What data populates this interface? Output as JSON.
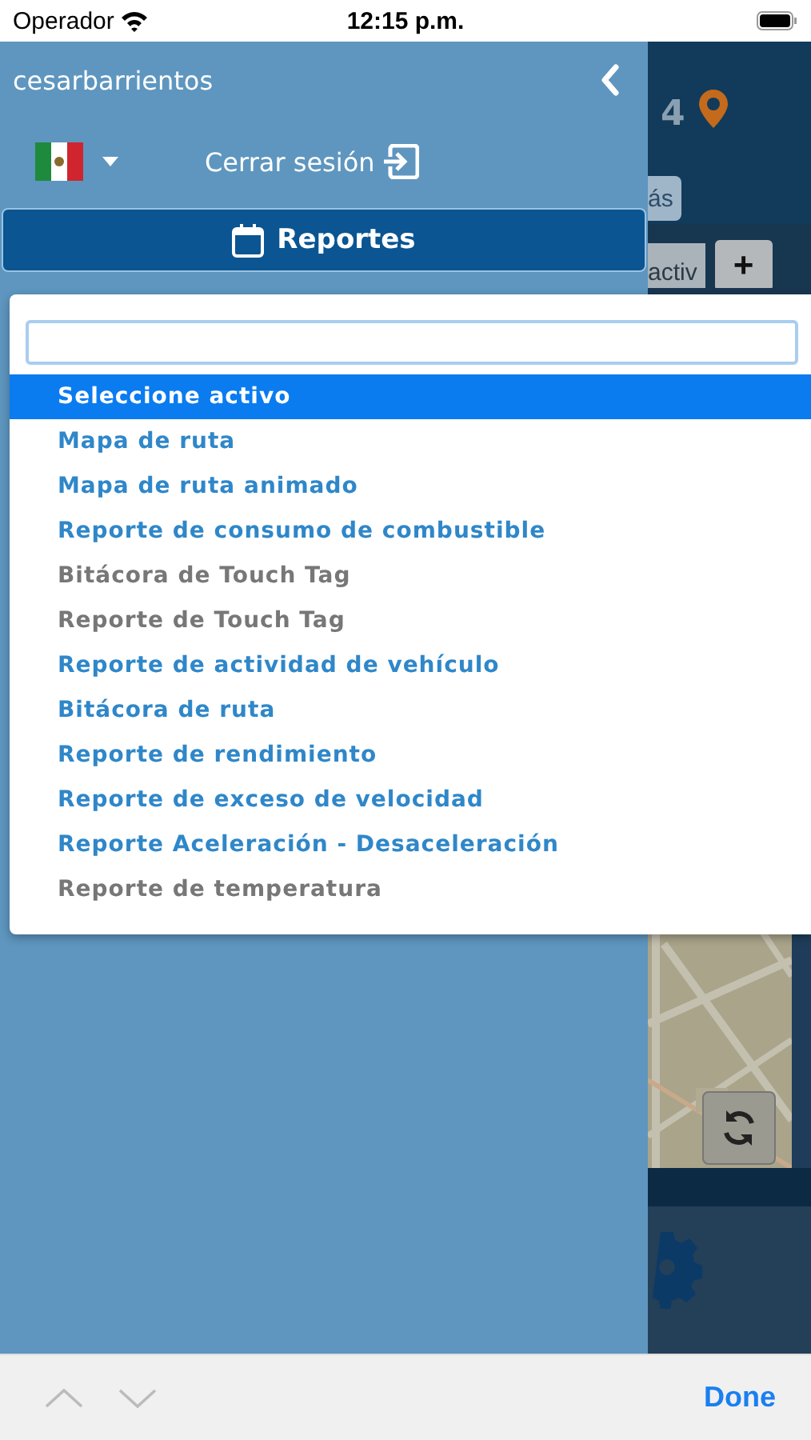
{
  "status_bar": {
    "carrier": "Operador",
    "time": "12:15 p.m."
  },
  "menu": {
    "username": "cesarbarrientos",
    "logout": "Cerrar sesión",
    "section_button": "Reportes"
  },
  "background": {
    "logo_text": "4",
    "more_button": "ás",
    "field_text": "activ",
    "zoom_button": "+"
  },
  "dropdown": {
    "options": [
      {
        "label": "Seleccione activo",
        "selected": true,
        "disabled": false
      },
      {
        "label": "Mapa de ruta",
        "selected": false,
        "disabled": false
      },
      {
        "label": "Mapa de ruta animado",
        "selected": false,
        "disabled": false
      },
      {
        "label": "Reporte de consumo de combustible",
        "selected": false,
        "disabled": false
      },
      {
        "label": "Bitácora de Touch Tag",
        "selected": false,
        "disabled": true
      },
      {
        "label": "Reporte de Touch Tag",
        "selected": false,
        "disabled": true
      },
      {
        "label": "Reporte de actividad de vehículo",
        "selected": false,
        "disabled": false
      },
      {
        "label": "Bitácora de ruta",
        "selected": false,
        "disabled": false
      },
      {
        "label": "Reporte de rendimiento",
        "selected": false,
        "disabled": false
      },
      {
        "label": "Reporte de exceso de velocidad",
        "selected": false,
        "disabled": false
      },
      {
        "label": "Reporte Aceleración - Desaceleración",
        "selected": false,
        "disabled": false
      },
      {
        "label": "Reporte de temperatura",
        "selected": false,
        "disabled": true
      }
    ]
  },
  "toolbar": {
    "done": "Done"
  }
}
